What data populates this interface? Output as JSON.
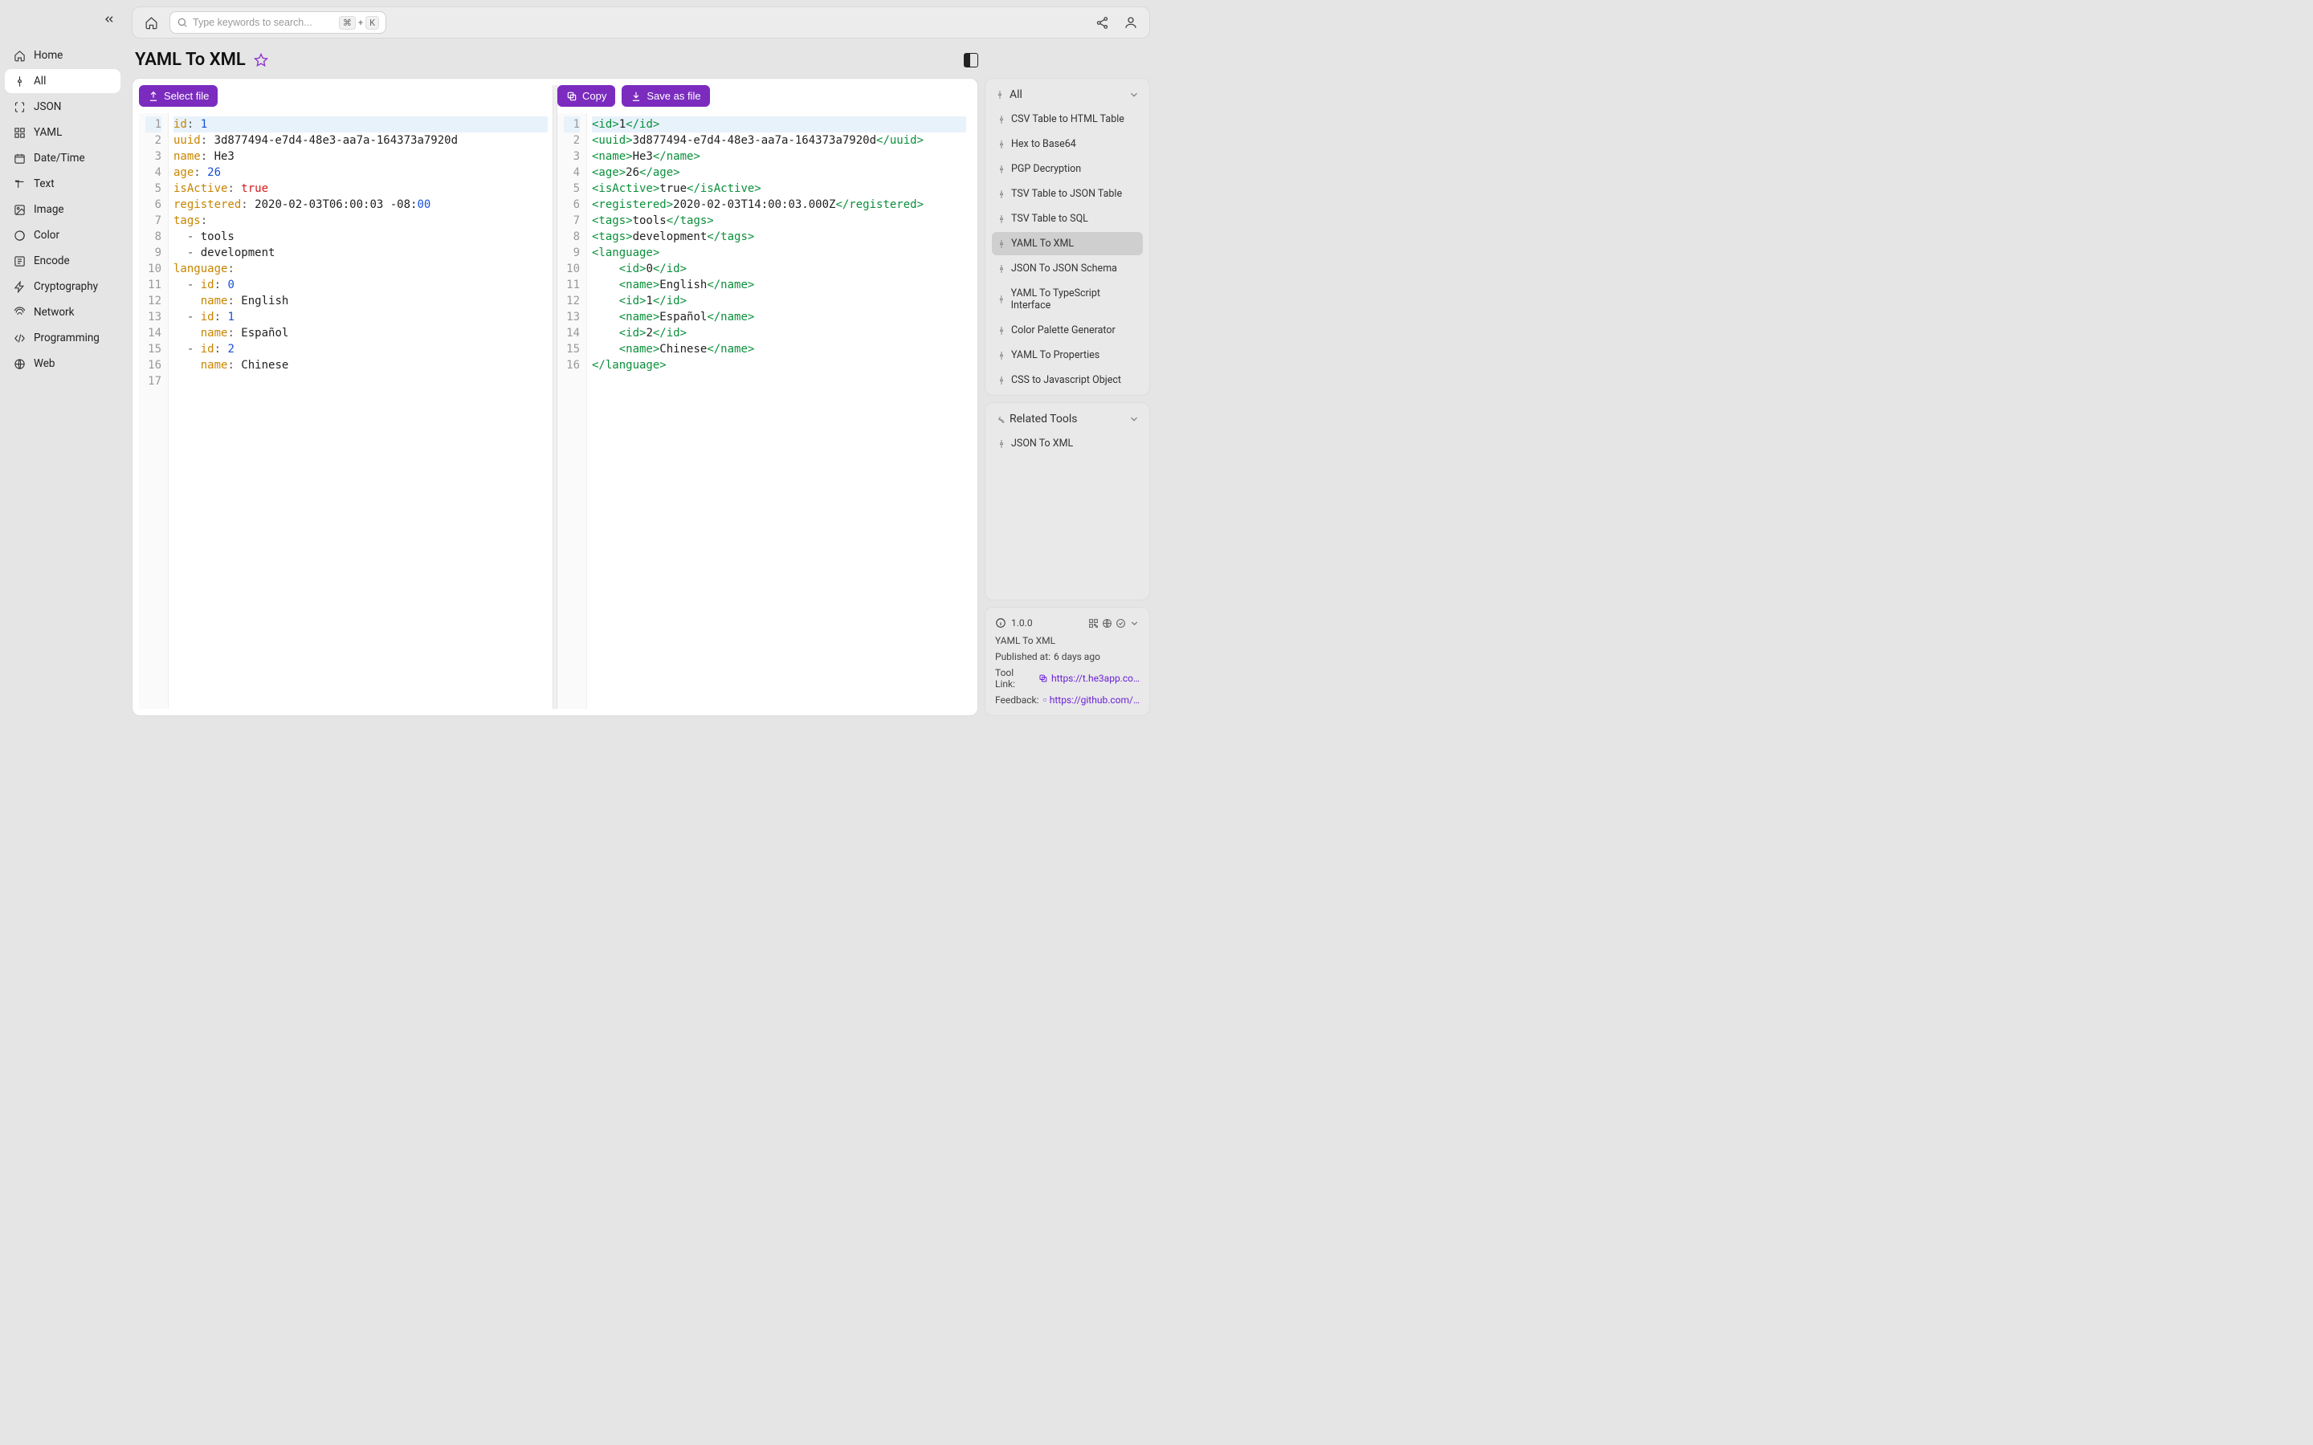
{
  "search": {
    "placeholder": "Type keywords to search...",
    "kbd1": "⌘",
    "kbd_plus": "+",
    "kbd2": "K"
  },
  "sidebar": {
    "items": [
      {
        "label": "Home"
      },
      {
        "label": "All"
      },
      {
        "label": "JSON"
      },
      {
        "label": "YAML"
      },
      {
        "label": "Date/Time"
      },
      {
        "label": "Text"
      },
      {
        "label": "Image"
      },
      {
        "label": "Color"
      },
      {
        "label": "Encode"
      },
      {
        "label": "Cryptography"
      },
      {
        "label": "Network"
      },
      {
        "label": "Programming"
      },
      {
        "label": "Web"
      }
    ]
  },
  "page": {
    "title": "YAML To XML"
  },
  "buttons": {
    "select_file": "Select file",
    "copy": "Copy",
    "save_as_file": "Save as file"
  },
  "yaml": {
    "lines": [
      [
        [
          "key",
          "id"
        ],
        [
          "punc",
          ": "
        ],
        [
          "num",
          "1"
        ]
      ],
      [
        [
          "key",
          "uuid"
        ],
        [
          "punc",
          ": "
        ],
        [
          "str",
          "3d877494-e7d4-48e3-aa7a-164373a7920d"
        ]
      ],
      [
        [
          "key",
          "name"
        ],
        [
          "punc",
          ": "
        ],
        [
          "str",
          "He3"
        ]
      ],
      [
        [
          "key",
          "age"
        ],
        [
          "punc",
          ": "
        ],
        [
          "num",
          "26"
        ]
      ],
      [
        [
          "key",
          "isActive"
        ],
        [
          "punc",
          ": "
        ],
        [
          "bool",
          "true"
        ]
      ],
      [
        [
          "key",
          "registered"
        ],
        [
          "punc",
          ": "
        ],
        [
          "str",
          "2020-02-03T06:00:03 -08:"
        ],
        [
          "num",
          "00"
        ]
      ],
      [
        [
          "key",
          "tags"
        ],
        [
          "punc",
          ":"
        ]
      ],
      [
        [
          "str",
          "  "
        ],
        [
          "minus",
          "- "
        ],
        [
          "str",
          "tools"
        ]
      ],
      [
        [
          "str",
          "  "
        ],
        [
          "minus",
          "- "
        ],
        [
          "str",
          "development"
        ]
      ],
      [
        [
          "key",
          "language"
        ],
        [
          "punc",
          ":"
        ]
      ],
      [
        [
          "str",
          "  "
        ],
        [
          "minus",
          "- "
        ],
        [
          "key",
          "id"
        ],
        [
          "punc",
          ": "
        ],
        [
          "num",
          "0"
        ]
      ],
      [
        [
          "str",
          "    "
        ],
        [
          "key",
          "name"
        ],
        [
          "punc",
          ": "
        ],
        [
          "str",
          "English"
        ]
      ],
      [
        [
          "str",
          "  "
        ],
        [
          "minus",
          "- "
        ],
        [
          "key",
          "id"
        ],
        [
          "punc",
          ": "
        ],
        [
          "num",
          "1"
        ]
      ],
      [
        [
          "str",
          "    "
        ],
        [
          "key",
          "name"
        ],
        [
          "punc",
          ": "
        ],
        [
          "str",
          "Español"
        ]
      ],
      [
        [
          "str",
          "  "
        ],
        [
          "minus",
          "- "
        ],
        [
          "key",
          "id"
        ],
        [
          "punc",
          ": "
        ],
        [
          "num",
          "2"
        ]
      ],
      [
        [
          "str",
          "    "
        ],
        [
          "key",
          "name"
        ],
        [
          "punc",
          ": "
        ],
        [
          "str",
          "Chinese"
        ]
      ],
      [
        [
          "str",
          ""
        ]
      ]
    ]
  },
  "xml": {
    "lines": [
      [
        [
          "tag",
          "<id>"
        ],
        [
          "text",
          "1"
        ],
        [
          "tag",
          "</id>"
        ]
      ],
      [
        [
          "tag",
          "<uuid>"
        ],
        [
          "text",
          "3d877494-e7d4-48e3-aa7a-164373a7920d"
        ],
        [
          "tag",
          "</uuid>"
        ]
      ],
      [
        [
          "tag",
          "<name>"
        ],
        [
          "text",
          "He3"
        ],
        [
          "tag",
          "</name>"
        ]
      ],
      [
        [
          "tag",
          "<age>"
        ],
        [
          "text",
          "26"
        ],
        [
          "tag",
          "</age>"
        ]
      ],
      [
        [
          "tag",
          "<isActive>"
        ],
        [
          "text",
          "true"
        ],
        [
          "tag",
          "</isActive>"
        ]
      ],
      [
        [
          "tag",
          "<registered>"
        ],
        [
          "text",
          "2020-02-03T14:00:03.000Z"
        ],
        [
          "tag",
          "</registered>"
        ]
      ],
      [
        [
          "tag",
          "<tags>"
        ],
        [
          "text",
          "tools"
        ],
        [
          "tag",
          "</tags>"
        ]
      ],
      [
        [
          "tag",
          "<tags>"
        ],
        [
          "text",
          "development"
        ],
        [
          "tag",
          "</tags>"
        ]
      ],
      [
        [
          "tag",
          "<language>"
        ]
      ],
      [
        [
          "str",
          "    "
        ],
        [
          "tag",
          "<id>"
        ],
        [
          "text",
          "0"
        ],
        [
          "tag",
          "</id>"
        ]
      ],
      [
        [
          "str",
          "    "
        ],
        [
          "tag",
          "<name>"
        ],
        [
          "text",
          "English"
        ],
        [
          "tag",
          "</name>"
        ]
      ],
      [
        [
          "str",
          "    "
        ],
        [
          "tag",
          "<id>"
        ],
        [
          "text",
          "1"
        ],
        [
          "tag",
          "</id>"
        ]
      ],
      [
        [
          "str",
          "    "
        ],
        [
          "tag",
          "<name>"
        ],
        [
          "text",
          "Español"
        ],
        [
          "tag",
          "</name>"
        ]
      ],
      [
        [
          "str",
          "    "
        ],
        [
          "tag",
          "<id>"
        ],
        [
          "text",
          "2"
        ],
        [
          "tag",
          "</id>"
        ]
      ],
      [
        [
          "str",
          "    "
        ],
        [
          "tag",
          "<name>"
        ],
        [
          "text",
          "Chinese"
        ],
        [
          "tag",
          "</name>"
        ]
      ],
      [
        [
          "tag",
          "</language>"
        ]
      ]
    ]
  },
  "all_panel": {
    "title": "All",
    "items": [
      "CSV Table to HTML Table",
      "Hex to Base64",
      "PGP Decryption",
      "TSV Table to JSON Table",
      "TSV Table to SQL",
      "YAML To XML",
      "JSON To JSON Schema",
      "YAML To TypeScript Interface",
      "Color Palette Generator",
      "YAML To Properties",
      "CSS to Javascript Object"
    ],
    "selected_index": 5
  },
  "related_panel": {
    "title": "Related Tools",
    "items": [
      "JSON To XML"
    ]
  },
  "info": {
    "version": "1.0.0",
    "name": "YAML To XML",
    "published_label": "Published at:",
    "published_value": "6 days ago",
    "tool_link_label": "Tool Link:",
    "tool_link_value": "https://t.he3app.co…",
    "feedback_label": "Feedback:",
    "feedback_value": "https://github.com/…"
  }
}
